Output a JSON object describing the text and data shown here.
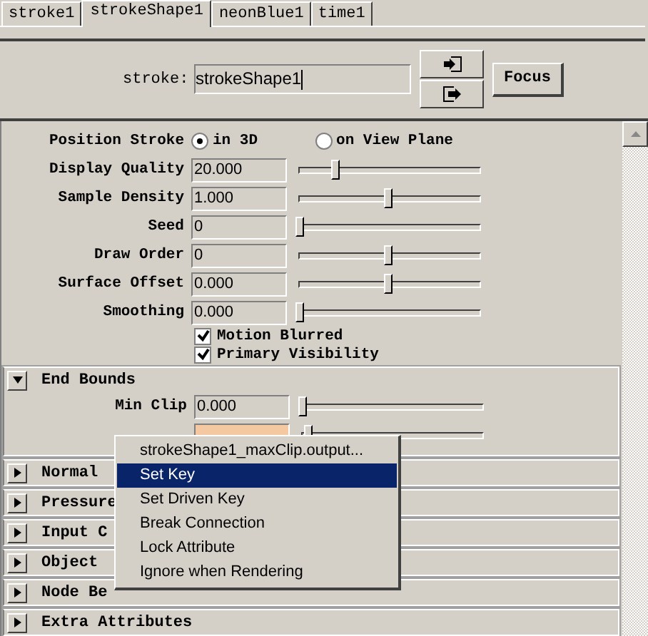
{
  "tabs": [
    {
      "label": "stroke1",
      "selected": false
    },
    {
      "label": "strokeShape1",
      "selected": true
    },
    {
      "label": "neonBlue1",
      "selected": false
    },
    {
      "label": "time1",
      "selected": false
    }
  ],
  "node_field": {
    "label": "stroke:",
    "value": "strokeShape1"
  },
  "focus_button": "Focus",
  "position_stroke": {
    "label": "Position Stroke",
    "options": [
      {
        "label": "in 3D",
        "selected": true
      },
      {
        "label": "on View Plane",
        "selected": false
      }
    ]
  },
  "attributes": [
    {
      "label": "Display Quality",
      "value": "20.000",
      "level": 0.2
    },
    {
      "label": "Sample Density",
      "value": "1.000",
      "level": 0.5
    },
    {
      "label": "Seed",
      "value": "0",
      "level": 0
    },
    {
      "label": "Draw Order",
      "value": "0",
      "level": 0.5
    },
    {
      "label": "Surface Offset",
      "value": "0.000",
      "level": 0.5
    },
    {
      "label": "Smoothing",
      "value": "0.000",
      "level": 0
    }
  ],
  "checkboxes": [
    {
      "label": "Motion Blurred",
      "checked": true
    },
    {
      "label": "Primary Visibility",
      "checked": true
    }
  ],
  "sections": [
    {
      "title": "End Bounds",
      "expanded": true,
      "attributes": [
        {
          "label": "Min Clip",
          "value": "0.000",
          "level": 0,
          "keyed": false
        },
        {
          "level": 0.03,
          "keyed": true
        }
      ]
    },
    {
      "title": "Normal",
      "expanded": false
    },
    {
      "title": "Pressure",
      "expanded": false
    },
    {
      "title": "Input C",
      "expanded": false
    },
    {
      "title": "Object",
      "expanded": false
    },
    {
      "title": "Node Be",
      "expanded": false
    },
    {
      "title": "Extra Attributes",
      "expanded": false
    }
  ],
  "context_menu": [
    {
      "label": "strokeShape1_maxClip.output...",
      "selected": false
    },
    {
      "label": "Set Key",
      "selected": true
    },
    {
      "label": "Set Driven Key",
      "selected": false
    },
    {
      "label": "Break Connection",
      "selected": false
    },
    {
      "label": "Lock Attribute",
      "selected": false
    },
    {
      "label": "Ignore when Rendering",
      "selected": false
    }
  ]
}
